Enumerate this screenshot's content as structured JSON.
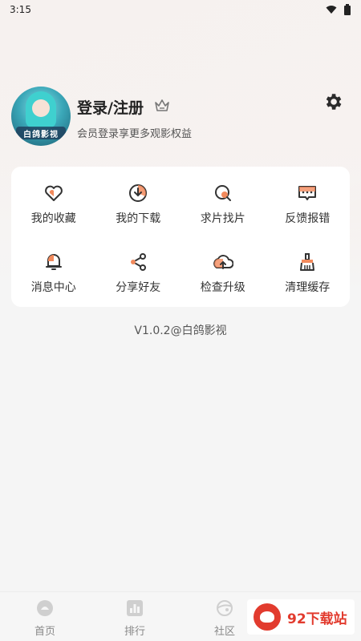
{
  "status_bar": {
    "time": "3:15"
  },
  "profile": {
    "title": "登录/注册",
    "subtitle": "会员登录享更多观影权益",
    "avatar_text": "白鸽影视"
  },
  "menu": {
    "items": [
      {
        "label": "我的收藏",
        "icon": "heart-icon"
      },
      {
        "label": "我的下载",
        "icon": "download-icon"
      },
      {
        "label": "求片找片",
        "icon": "search-film-icon"
      },
      {
        "label": "反馈报错",
        "icon": "feedback-icon"
      },
      {
        "label": "消息中心",
        "icon": "bell-icon"
      },
      {
        "label": "分享好友",
        "icon": "share-icon"
      },
      {
        "label": "检查升级",
        "icon": "upgrade-icon"
      },
      {
        "label": "清理缓存",
        "icon": "broom-icon"
      }
    ]
  },
  "version": "V1.0.2@白鸽影视",
  "bottom_nav": {
    "items": [
      {
        "label": "首页",
        "icon": "home-icon"
      },
      {
        "label": "排行",
        "icon": "rank-icon"
      },
      {
        "label": "社区",
        "icon": "community-icon"
      }
    ]
  },
  "watermark": {
    "text": "92下载站"
  },
  "colors": {
    "accent": "#f28a5c",
    "icon_stroke": "#333333"
  }
}
